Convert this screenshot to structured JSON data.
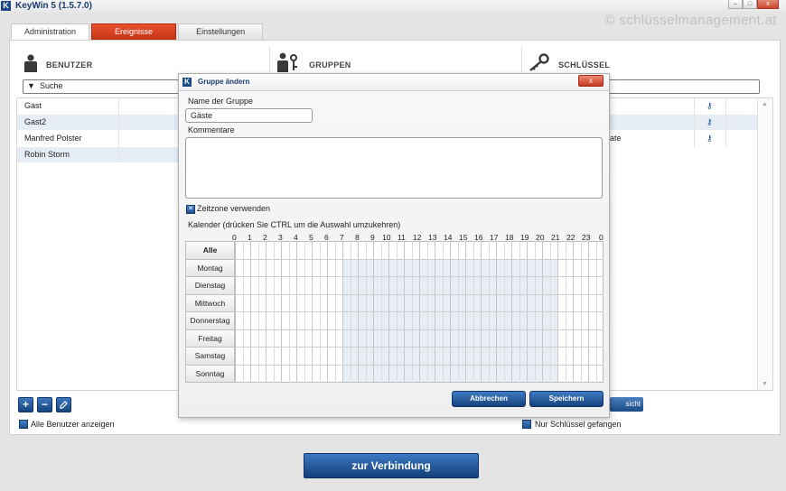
{
  "app": {
    "title": "KeyWin 5 (1.5.7.0)",
    "logo": "K"
  },
  "watermark": "© schlüsselmanagement.at",
  "tabs": [
    {
      "label": "Administration",
      "active": true
    },
    {
      "label": "Ereignisse",
      "highlight": "#d7401f"
    },
    {
      "label": "Einstellungen"
    }
  ],
  "columns": {
    "benutzer": "BENUTZER",
    "gruppen": "GRUPPEN",
    "schluessel": "SCHLÜSSEL"
  },
  "search": {
    "arrow": "▼",
    "placeholder": "Suche"
  },
  "users": [
    "Gast",
    "Gast2",
    "Manfred Polster",
    "Robin Storm"
  ],
  "right_list": {
    "row3_text": "ate"
  },
  "bottom": {
    "add": "+",
    "remove": "−",
    "edit_icon": "pencil-icon",
    "show_all_users": "Alle Benutzer anzeigen",
    "only_keys_captured": "Nur Schlüssel gefangen",
    "partial_button": "sicht"
  },
  "connect_button": "zur Verbindung",
  "dialog": {
    "logo": "K",
    "title": "Gruppe ändern",
    "close": "x",
    "name_label": "Name der Gruppe",
    "name_value": "Gäste",
    "comments_label": "Kommentare",
    "comments_value": "",
    "timezone_label": "Zeitzone verwenden",
    "timezone_checked": true,
    "calendar_label": "Kalender (drücken Sie CTRL um die Auswahl umzukehren)",
    "hours": [
      "0",
      "1",
      "2",
      "3",
      "4",
      "5",
      "6",
      "7",
      "8",
      "9",
      "10",
      "11",
      "12",
      "13",
      "14",
      "15",
      "16",
      "17",
      "18",
      "19",
      "20",
      "21",
      "22",
      "23",
      "0"
    ],
    "days": [
      "Alle",
      "Montag",
      "Dienstag",
      "Mittwoch",
      "Donnerstag",
      "Freitag",
      "Samstag",
      "Sonntag"
    ],
    "selected_hours": {
      "from": 7,
      "to": 21
    },
    "cancel": "Abbrechen",
    "save": "Speichern"
  },
  "colors": {
    "accent": "#1f4f8c",
    "tab_red": "#d7401f",
    "selection": "#e8eef6"
  }
}
